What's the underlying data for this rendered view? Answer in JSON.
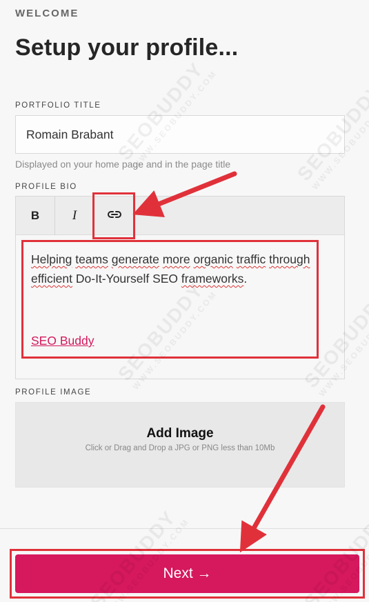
{
  "header": {
    "eyebrow": "WELCOME",
    "title": "Setup your profile..."
  },
  "portfolio": {
    "label": "PORTFOLIO TITLE",
    "value": "Romain Brabant",
    "helper": "Displayed on your home page and in the page title"
  },
  "bio": {
    "label": "PROFILE BIO",
    "toolbar": {
      "bold_label": "B",
      "italic_label": "I",
      "link_icon": "link-icon"
    },
    "words": [
      "Helping",
      "teams",
      "generate",
      "more",
      "organic",
      "traffic",
      "through",
      "efficient",
      "Do-It-Yourself SEO",
      "frameworks",
      "."
    ],
    "link_text": "SEO Buddy",
    "link_color": "#d3185b"
  },
  "profile_image": {
    "label": "PROFILE IMAGE",
    "title": "Add Image",
    "hint": "Click or Drag and Drop a JPG or PNG less than 10Mb"
  },
  "footer": {
    "next_label": "Next →",
    "next_color": "#d6185d"
  },
  "watermark": {
    "brand": "SEOBUDDY",
    "site": "WWW.SEOBUDDY.COM"
  },
  "annotations": {
    "highlight_color": "#e0313a"
  }
}
